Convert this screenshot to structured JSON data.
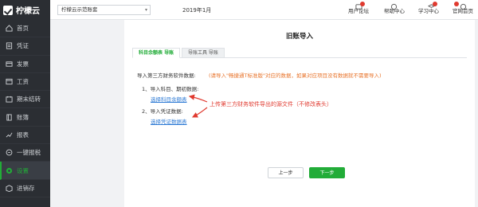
{
  "app": {
    "name": "柠檬云"
  },
  "sidebar": {
    "items": [
      {
        "label": "首页",
        "icon": "home-icon"
      },
      {
        "label": "凭证",
        "icon": "voucher-icon"
      },
      {
        "label": "发票",
        "icon": "invoice-icon"
      },
      {
        "label": "工资",
        "icon": "salary-icon"
      },
      {
        "label": "期末结转",
        "icon": "period-close-icon"
      },
      {
        "label": "账簿",
        "icon": "ledger-icon"
      },
      {
        "label": "报表",
        "icon": "report-icon"
      },
      {
        "label": "一键报税",
        "icon": "tax-icon"
      },
      {
        "label": "设置",
        "icon": "gear-icon",
        "active": true
      },
      {
        "label": "进销存",
        "icon": "inventory-icon"
      }
    ]
  },
  "topbar": {
    "company": "柠檬云示范账套",
    "period": "2019年1月",
    "links": [
      {
        "label": "用户论坛"
      },
      {
        "label": "帮助中心"
      },
      {
        "label": "学习中心"
      },
      {
        "label": "官网首页"
      }
    ]
  },
  "main": {
    "title": "旧账导入",
    "tabs": [
      {
        "label": "科目余额表 导账"
      },
      {
        "label": "导账工具 导账"
      }
    ],
    "intro": "导入第三方财务软件数据:",
    "warning": "(请导入\"畅捷通T标准版\"对应的数据，如果对应项目没有数据就不需要导入)",
    "step1_label": "1、导入科目、期初数据:",
    "step1_link": "选择科目余额表",
    "step2_label": "2、导入凭证数据:",
    "step2_link": "选择凭证数据表",
    "annotation": "上传第三方财务软件导出的源文件（不修改表头）",
    "prev_button": "上一步",
    "next_button": "下一步"
  },
  "colors": {
    "accent": "#22ac38",
    "sidebar_bg": "#2b2e33",
    "warning": "#e8742b",
    "annotation": "#e03a2f",
    "link": "#2a78d4"
  }
}
